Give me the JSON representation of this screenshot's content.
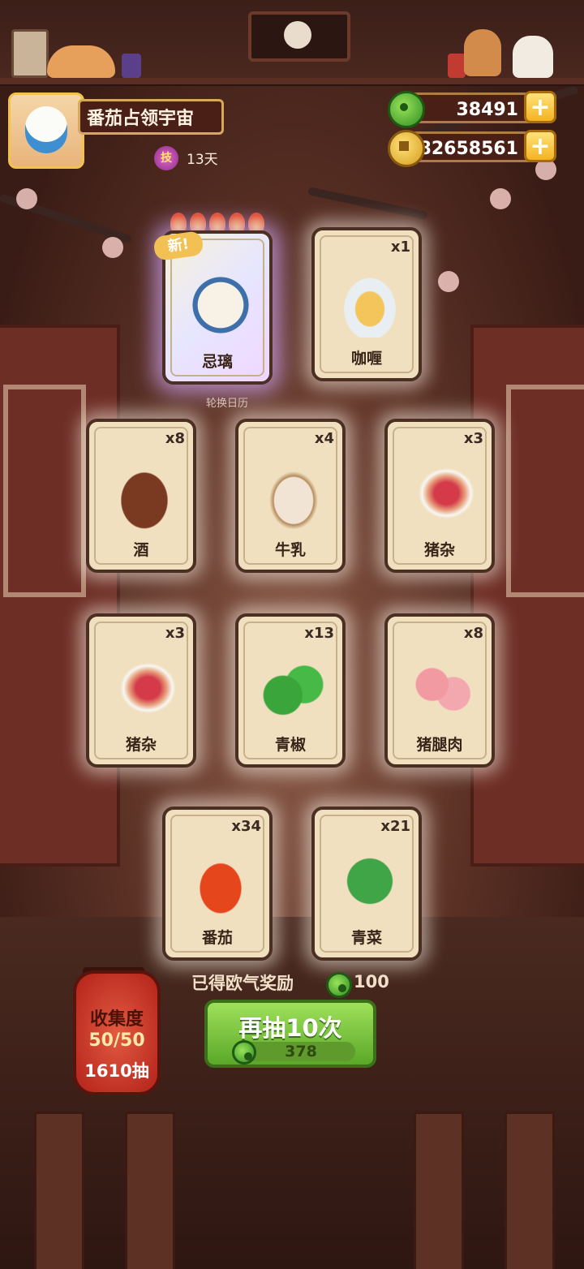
{
  "player": {
    "name": "番茄占领宇宙",
    "skill_badge": "技",
    "skill_days": "13天"
  },
  "currency": {
    "jade": "38491",
    "coins": "82658561",
    "add_symbol": "+"
  },
  "banner": {
    "new_tag": "新!",
    "sub_label": "轮换日历"
  },
  "cards": [
    {
      "label": "忌璃",
      "count": "",
      "art": "character-card-art"
    },
    {
      "label": "咖喱",
      "count": "x1",
      "art": "curry-gravy-boat-icon"
    },
    {
      "label": "酒",
      "count": "x8",
      "art": "wine-jar-icon"
    },
    {
      "label": "牛乳",
      "count": "x4",
      "art": "milk-bottle-icon"
    },
    {
      "label": "猪杂",
      "count": "x3",
      "art": "pork-offal-plate-icon"
    },
    {
      "label": "猪杂",
      "count": "x3",
      "art": "pork-offal-plate-icon"
    },
    {
      "label": "青椒",
      "count": "x13",
      "art": "green-pepper-icon"
    },
    {
      "label": "猪腿肉",
      "count": "x8",
      "art": "pork-leg-meat-icon"
    },
    {
      "label": "番茄",
      "count": "x34",
      "art": "tomato-icon"
    },
    {
      "label": "青菜",
      "count": "x21",
      "art": "green-vegetable-icon"
    }
  ],
  "collection": {
    "title": "收集度",
    "progress": "50/50",
    "draws": "1610抽"
  },
  "reward": {
    "text": "已得欧气奖励",
    "value": "100"
  },
  "draw_button": {
    "label": "再抽10次",
    "cost": "378"
  },
  "colors": {
    "card_bg": "#f0e0c0",
    "draw_green": "#6bb832",
    "currency_bar": "#4a2016"
  }
}
